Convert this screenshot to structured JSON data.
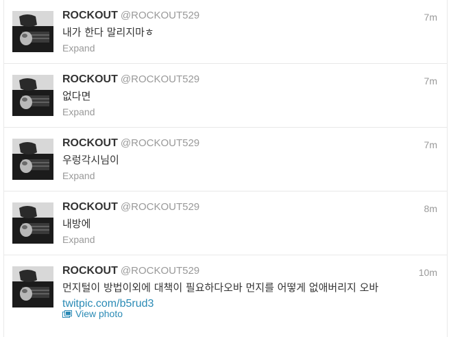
{
  "tweets": [
    {
      "fullname": "ROCKOUT",
      "screen_name": "@ROCKOUT529",
      "time": "7m",
      "text": "내가 한다 말리지마ㅎ",
      "action": "Expand"
    },
    {
      "fullname": "ROCKOUT",
      "screen_name": "@ROCKOUT529",
      "time": "7m",
      "text": "없다면",
      "action": "Expand"
    },
    {
      "fullname": "ROCKOUT",
      "screen_name": "@ROCKOUT529",
      "time": "7m",
      "text": "우렁각시님이",
      "action": "Expand"
    },
    {
      "fullname": "ROCKOUT",
      "screen_name": "@ROCKOUT529",
      "time": "8m",
      "text": "내방에",
      "action": "Expand"
    },
    {
      "fullname": "ROCKOUT",
      "screen_name": "@ROCKOUT529",
      "time": "10m",
      "text": "먼지털이 방법이외에 대책이 필요하다오바 먼지를 어떻게 없애버리지 오바 ",
      "link": "twitpic.com/b5rud3",
      "action": "View photo"
    }
  ],
  "colors": {
    "fullname": "#333333",
    "meta": "#999999",
    "link": "#2a8ab5",
    "divider": "#e8e8e8"
  },
  "icons": {
    "avatar": "avatar-photo",
    "view_photo": "photo-icon"
  }
}
